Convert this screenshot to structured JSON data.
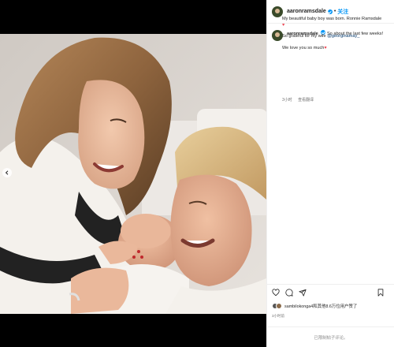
{
  "post": {
    "username": "aaronramsdale",
    "separator": "•",
    "follow_label": "关注",
    "caption_first": "So about the last few weeks!",
    "caption_lines": [
      "My beautiful baby boy was born. Ronnie Ramsdale",
      "So grateful for my wife",
      "We love you so much"
    ],
    "mention": "@georginamay_",
    "heart": "♥",
    "time_ago": "3小时",
    "see_translation": "查看翻译",
    "likes_text": "sambilokonga4和其他8.6万位用户赞了",
    "date": "3小时前",
    "comment_placeholder": "已限制帖子评论。"
  },
  "icons": {
    "like": "heart-outline-icon",
    "comment": "comment-icon",
    "share": "share-icon",
    "save": "bookmark-icon",
    "prev": "chevron-left-icon"
  },
  "colors": {
    "link": "#0095f6",
    "heart": "#ed4956",
    "muted": "#737373"
  }
}
